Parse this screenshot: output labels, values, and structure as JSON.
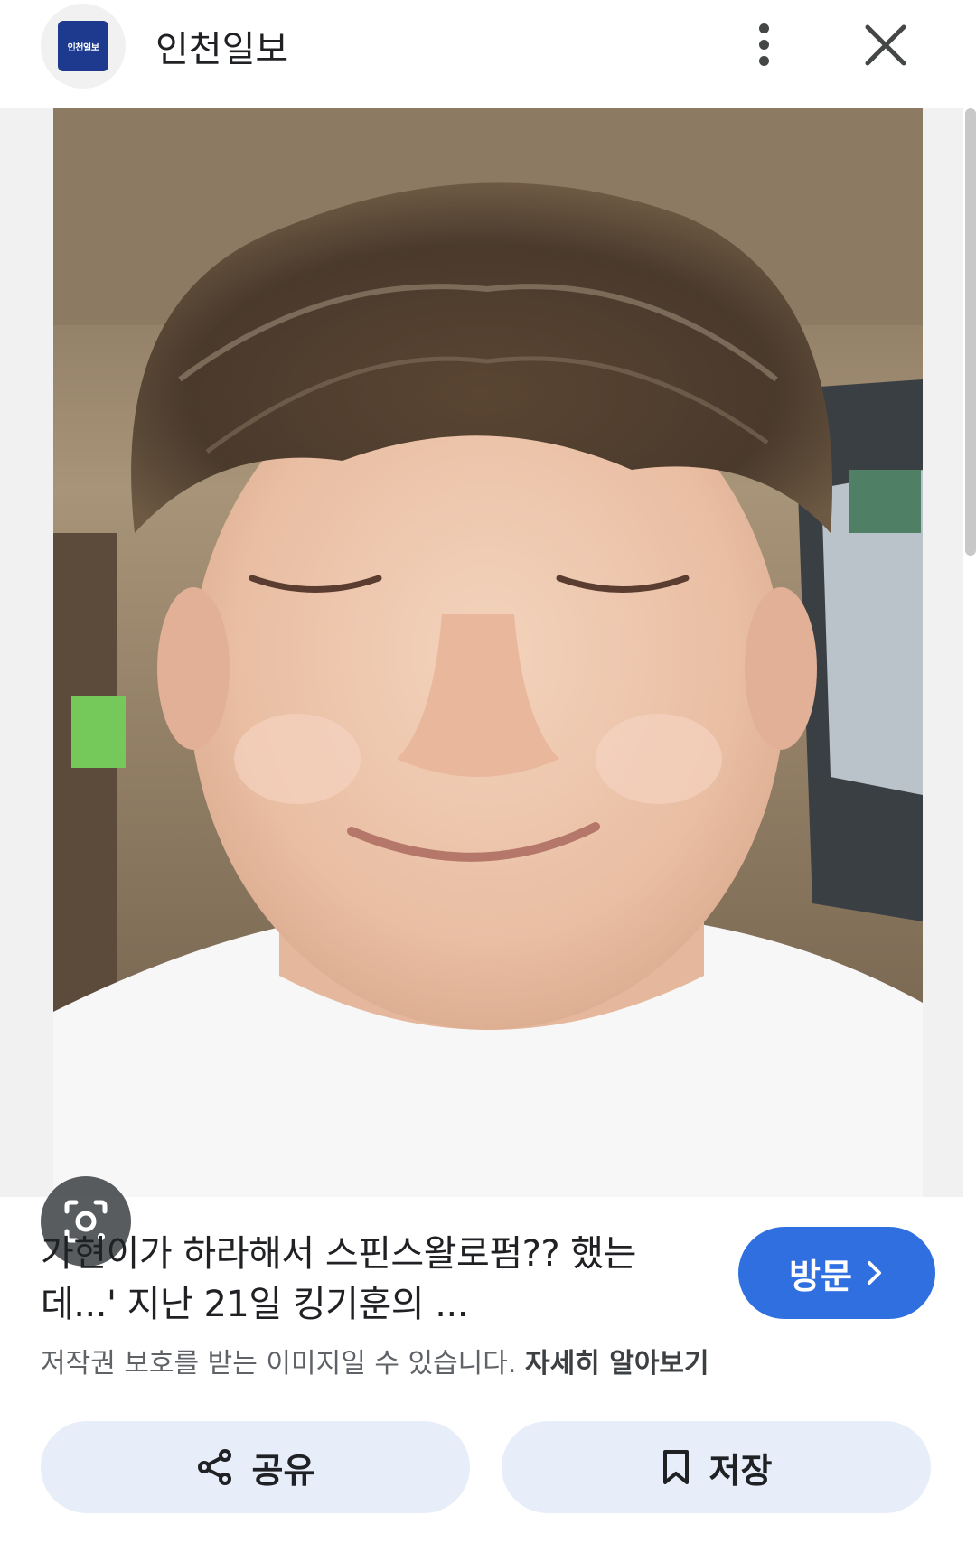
{
  "header": {
    "logo_text": "인천일보",
    "site_name": "인천일보",
    "more_icon": "more-vert-icon",
    "close_icon": "close-icon"
  },
  "image": {
    "lens_icon": "google-lens-icon"
  },
  "caption": {
    "title": "가현이가 하라해서 스핀스왈로펌?? 했는데...' 지난 21일 킹기훈의 ...",
    "visit_label": "방문",
    "copyright_text": "저작권 보호를 받는 이미지일 수 있습니다.",
    "learn_more": "자세히 알아보기"
  },
  "actions": {
    "share_label": "공유",
    "save_label": "저장"
  },
  "colors": {
    "accent": "#2f6fe0",
    "action_bg": "#e8eef9",
    "logo_bg": "#1d3a8f"
  }
}
